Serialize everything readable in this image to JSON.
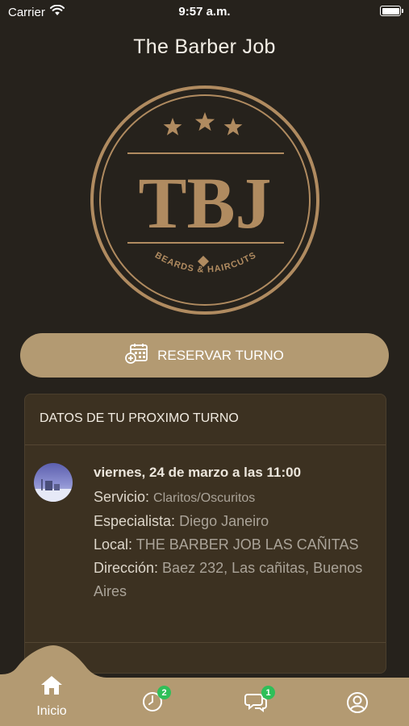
{
  "status_bar": {
    "carrier": "Carrier",
    "time": "9:57 a.m.",
    "icons": [
      "wifi-icon",
      "battery-icon"
    ]
  },
  "header": {
    "title": "The Barber Job"
  },
  "logo": {
    "initials": "TBJ",
    "tagline": "BEARDS & HAIRCUTS",
    "stars": 3,
    "colors": {
      "gold": "#b08b60",
      "background": "#26221c"
    }
  },
  "reserve_button": {
    "label": "RESERVAR TURNO",
    "icon": "calendar-add-icon"
  },
  "next_appointment": {
    "title": "DATOS DE TU PROXIMO TURNO",
    "date": "viernes, 24 de marzo a las 11:00",
    "service_label": "Servicio:",
    "service": "Claritos/Oscuritos",
    "specialist_label": "Especialista:",
    "specialist": "Diego Janeiro",
    "location_label": "Local:",
    "location": "THE BARBER JOB LAS CAÑITAS",
    "address_label": "Dirección:",
    "address": "Baez 232, Las cañitas, Buenos Aires"
  },
  "tab_bar": {
    "tabs": [
      {
        "label": "Inicio",
        "icon": "home-icon",
        "active": true
      },
      {
        "icon": "clock-icon",
        "badge": "2"
      },
      {
        "icon": "chat-icon",
        "badge": "1"
      },
      {
        "icon": "user-icon"
      }
    ],
    "colors": {
      "bar": "#b39a72",
      "badge": "#2fbf59"
    }
  }
}
